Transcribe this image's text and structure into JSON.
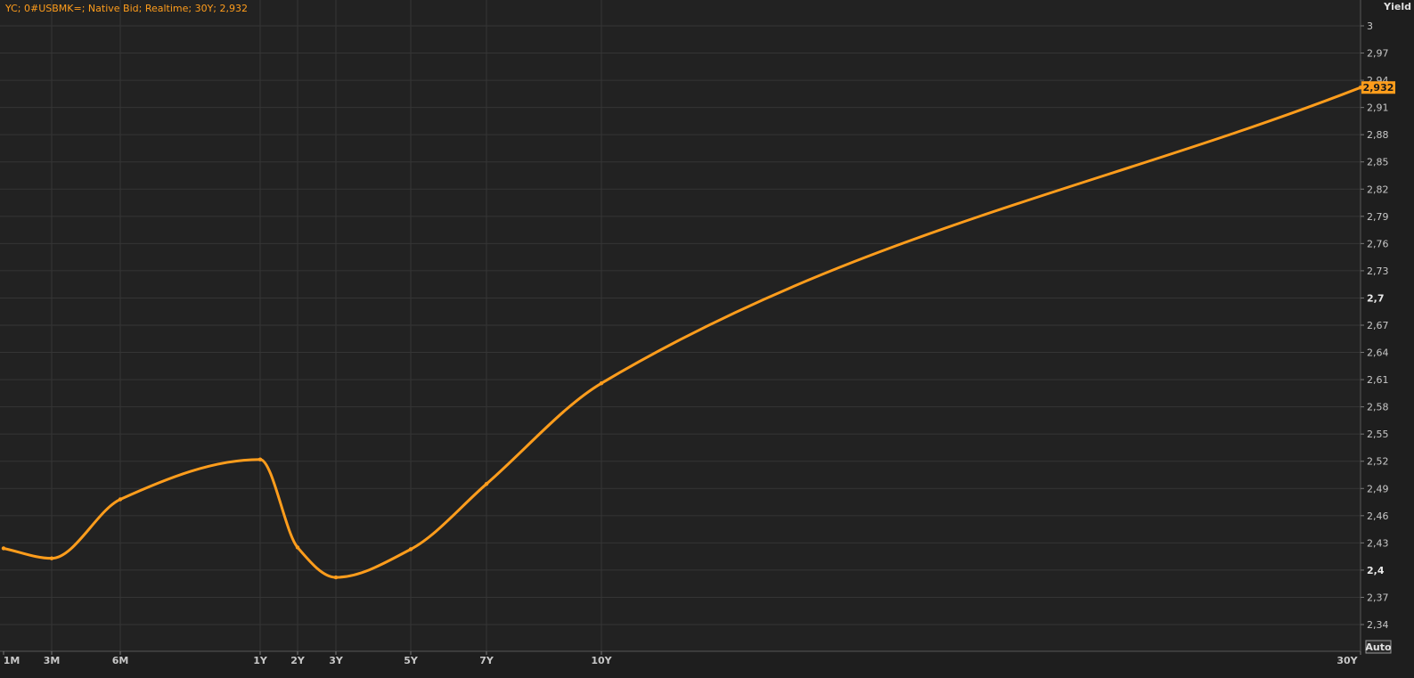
{
  "header": {
    "title": "YC; 0#USBMK=; Native Bid; Realtime; 30Y; 2,932"
  },
  "axis": {
    "ylabel": "Yield",
    "auto_label": "Auto",
    "last_value_label": "2,932"
  },
  "colors": {
    "background": "#1e1e1e",
    "plot_background": "#222222",
    "grid": "#353535",
    "line": "#ff9d1c",
    "text": "#c8c8c8"
  },
  "chart_data": {
    "type": "line",
    "title": "YC; 0#USBMK=; Native Bid; Realtime; 30Y; 2,932",
    "xlabel": "",
    "ylabel": "Yield",
    "ylim": [
      2.31,
      3.01
    ],
    "grid": true,
    "y_axis_position": "right",
    "x_scale": "tenor (log-like)",
    "x_ticks": [
      "1M",
      "3M",
      "6M",
      "1Y",
      "2Y",
      "3Y",
      "5Y",
      "7Y",
      "10Y",
      "30Y"
    ],
    "y_ticks": [
      "3",
      "2,97",
      "2,94",
      "2,91",
      "2,88",
      "2,85",
      "2,82",
      "2,79",
      "2,76",
      "2,73",
      "2,7",
      "2,67",
      "2,64",
      "2,61",
      "2,58",
      "2,55",
      "2,52",
      "2,49",
      "2,46",
      "2,43",
      "2,4",
      "2,37",
      "2,34"
    ],
    "y_tick_values": [
      3.0,
      2.97,
      2.94,
      2.91,
      2.88,
      2.85,
      2.82,
      2.79,
      2.76,
      2.73,
      2.7,
      2.67,
      2.64,
      2.61,
      2.58,
      2.55,
      2.52,
      2.49,
      2.46,
      2.43,
      2.4,
      2.37,
      2.34
    ],
    "series": [
      {
        "x": [
          "1M",
          "3M",
          "6M",
          "1Y",
          "2Y",
          "3Y",
          "5Y",
          "7Y",
          "10Y",
          "30Y"
        ],
        "values": [
          2.424,
          2.413,
          2.478,
          2.522,
          2.425,
          2.392,
          2.423,
          2.495,
          2.606,
          2.932
        ]
      }
    ]
  }
}
